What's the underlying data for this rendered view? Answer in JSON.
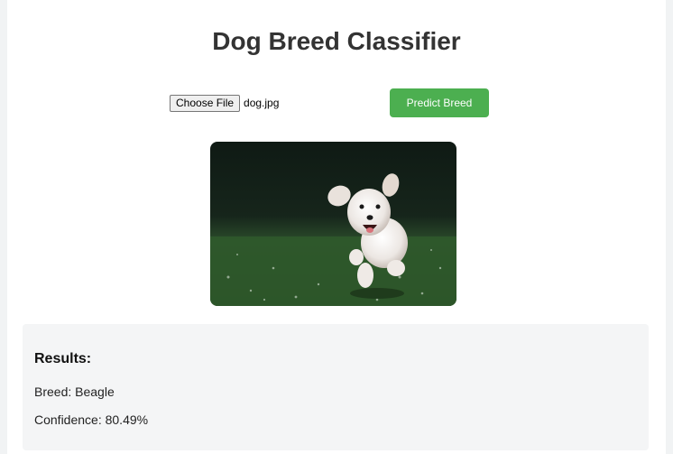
{
  "page": {
    "title": "Dog Breed Classifier"
  },
  "upload": {
    "choose_file_label": "Choose File",
    "file_name": "dog.jpg",
    "predict_label": "Predict Breed"
  },
  "preview": {
    "subject": "dog-photo"
  },
  "results": {
    "heading": "Results:",
    "breed_text": "Breed: Beagle",
    "confidence_text": "Confidence: 80.49%"
  },
  "colors": {
    "accent": "#4caf50",
    "title": "#333333",
    "results_bg": "#f4f5f6"
  }
}
